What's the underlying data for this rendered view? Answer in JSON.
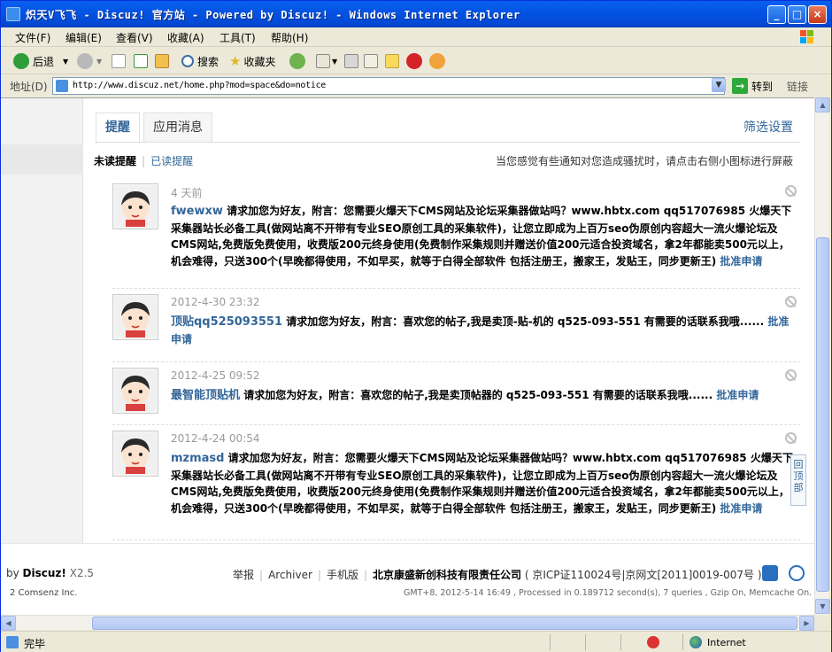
{
  "window": {
    "title": "炽天V飞飞 - Discuz! 官方站 - Powered by Discuz! - Windows Internet Explorer"
  },
  "menu": [
    "文件(F)",
    "编辑(E)",
    "查看(V)",
    "收藏(A)",
    "工具(T)",
    "帮助(H)"
  ],
  "toolbar": {
    "back": "后退",
    "search": "搜索",
    "favorites": "收藏夹"
  },
  "address": {
    "label": "地址(D)",
    "url": "http://www.discuz.net/home.php?mod=space&do=notice",
    "go": "转到",
    "links": "链接"
  },
  "notice": {
    "tabs": [
      "提醒",
      "应用消息"
    ],
    "settings": "筛选设置",
    "subnav_current": "未读提醒",
    "subnav_other": "已读提醒",
    "hint": "当您感觉有些通知对您造成骚扰时，请点击右侧小图标进行屏蔽",
    "items": [
      {
        "time": "4 天前",
        "user": "fwewxw",
        "text": " 请求加您为好友，附言：您需要火爆天下CMS网站及论坛采集器做站吗？www.hbtx.com qq517076985 火爆天下采集器站长必备工具(做网站离不开带有专业SEO原创工具的采集软件)，让您立即成为上百万seo伪原创内容超大一流火爆论坛及CMS网站,免费版免费使用，收费版200元终身使用(免费制作采集规则并赠送价值200元适合投资域名，拿2年都能卖500元以上，机会难得，只送300个(早晚都得使用，不如早买，就等于白得全部软件 包括注册王，搬家王，发贴王，同步更新王)",
        "approve": "批准申请"
      },
      {
        "time": "2012-4-30 23:32",
        "user": "顶贴qq525093551",
        "text": " 请求加您为好友，附言：喜欢您的帖子,我是卖顶-贴-机的 q525-093-551 有需要的话联系我哦......",
        "approve": "批准申请"
      },
      {
        "time": "2012-4-25 09:52",
        "user": "最智能顶贴机",
        "text": " 请求加您为好友，附言：喜欢您的帖子,我是卖顶帖器的 q525-093-551 有需要的话联系我哦......",
        "approve": "批准申请"
      },
      {
        "time": "2012-4-24 00:54",
        "user": "mzmasd",
        "text": " 请求加您为好友，附言：您需要火爆天下CMS网站及论坛采集器做站吗？www.hbtx.com qq517076985 火爆天下采集器站长必备工具(做网站离不开带有专业SEO原创工具的采集软件)，让您立即成为上百万seo伪原创内容超大一流火爆论坛及CMS网站,免费版免费使用，收费版200元终身使用(免费制作采集规则并赠送价值200元适合投资域名，拿2年都能卖500元以上，机会难得，只送300个(早晚都得使用，不如早买，就等于白得全部软件 包括注册王，搬家王，发贴王，同步更新王)",
        "approve": "批准申请"
      }
    ],
    "backtop": "回顶部"
  },
  "footer": {
    "powered_prefix": "by",
    "brand": "Discuz!",
    "version": "X2.5",
    "copyright": "2 Comsenz Inc.",
    "link_report": "举报",
    "link_archiver": "Archiver",
    "link_mobile": "手机版",
    "company": "北京康盛新创科技有限责任公司",
    "icp": "( 京ICP证110024号|京网文[2011]0019-007号 )",
    "gmt": "GMT+8, 2012-5-14 16:49 , Processed in 0.189712 second(s), 7 queries , Gzip On, Memcache On."
  },
  "status": {
    "text": "完毕",
    "zone": "Internet"
  }
}
